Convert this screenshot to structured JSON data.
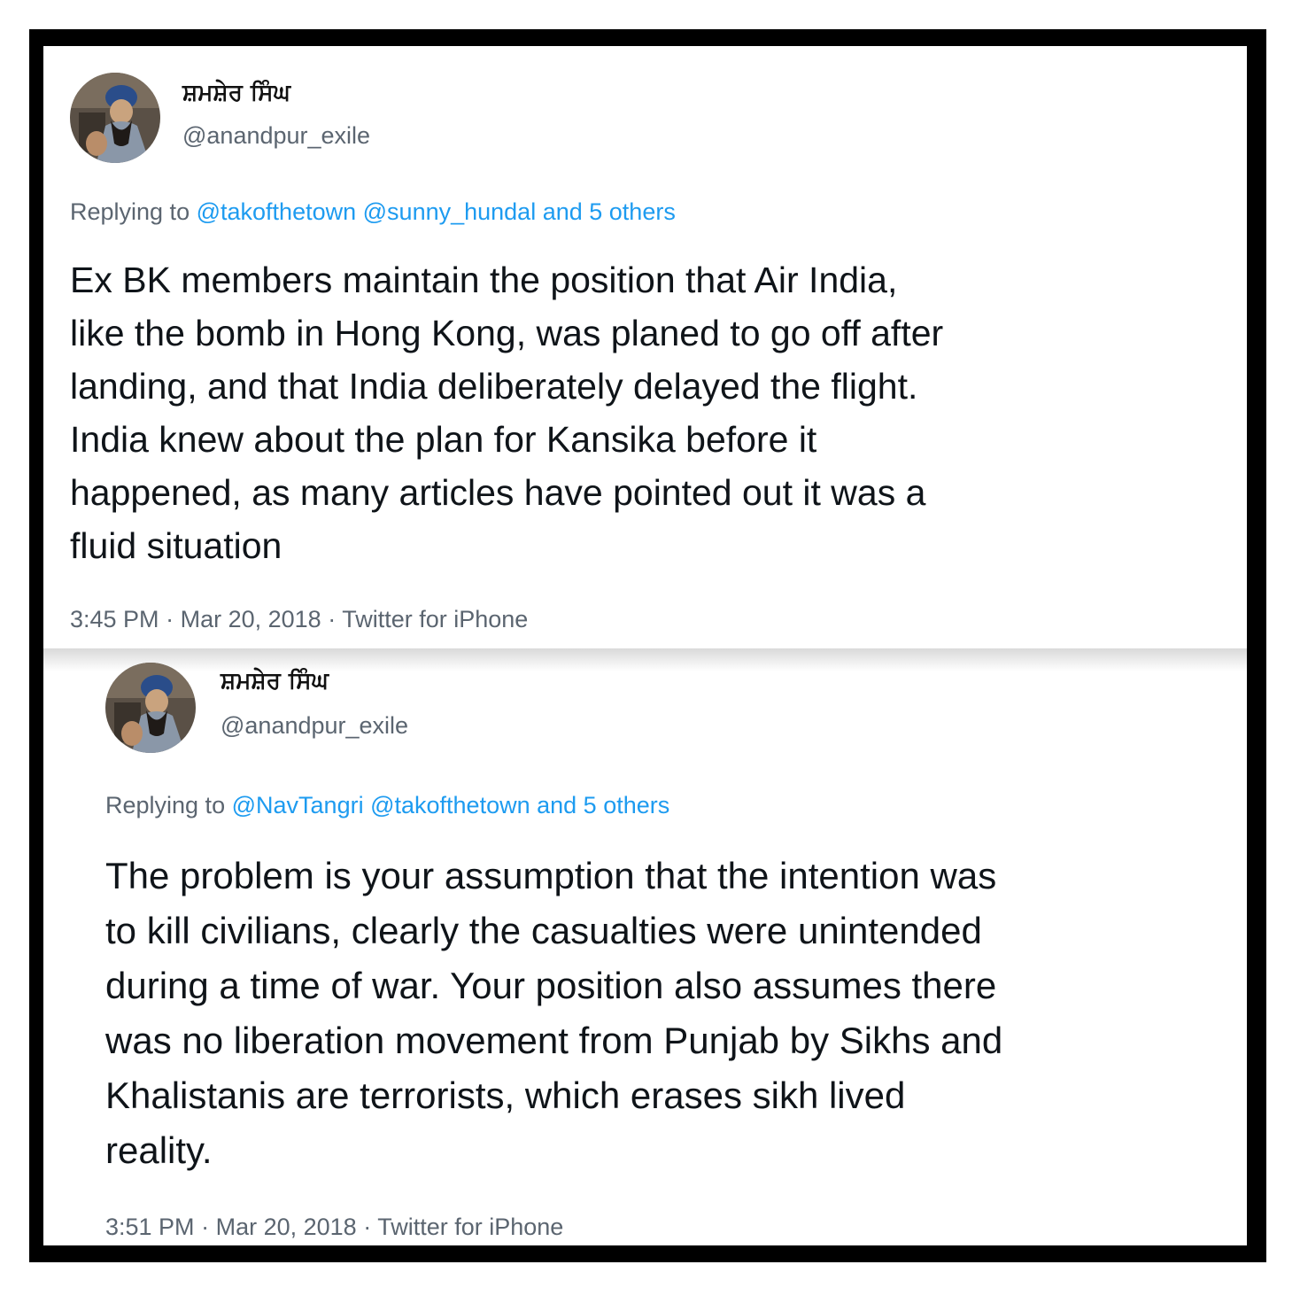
{
  "tweets": [
    {
      "display_name": "ਸ਼ਮਸ਼ੇਰ ਸਿੰਘ",
      "handle": "@anandpur_exile",
      "replying_prefix": "Replying to",
      "replying_mentions": [
        "@takofthetown",
        "@sunny_hundal"
      ],
      "replying_others": "and 5 others",
      "body_lines": [
        "Ex BK members maintain the position that Air India,",
        "like the bomb in Hong Kong, was planed to go off after",
        "landing, and that India deliberately delayed the flight.",
        "India knew about the plan for Kansika before it",
        "happened, as many articles have pointed out it was a",
        "fluid situation"
      ],
      "time": "3:45 PM",
      "date": "Mar 20, 2018",
      "source": "Twitter for iPhone"
    },
    {
      "display_name": "ਸ਼ਮਸ਼ੇਰ ਸਿੰਘ",
      "handle": "@anandpur_exile",
      "replying_prefix": "Replying to",
      "replying_mentions": [
        "@NavTangri",
        "@takofthetown"
      ],
      "replying_others": "and 5 others",
      "body_lines": [
        "The problem is your assumption that the intention was",
        "to kill civilians, clearly the casualties were unintended",
        "during a time of war. Your position also assumes there",
        "was no liberation movement from Punjab by Sikhs and",
        "Khalistanis are terrorists, which erases sikh lived",
        "reality."
      ],
      "time": "3:51 PM",
      "date": "Mar 20, 2018",
      "source": "Twitter for iPhone"
    }
  ],
  "separator": "·",
  "colors": {
    "frame": "#000000",
    "link": "#1d9bf0",
    "secondary_text": "#5b6570",
    "primary_text": "#0f1419"
  }
}
